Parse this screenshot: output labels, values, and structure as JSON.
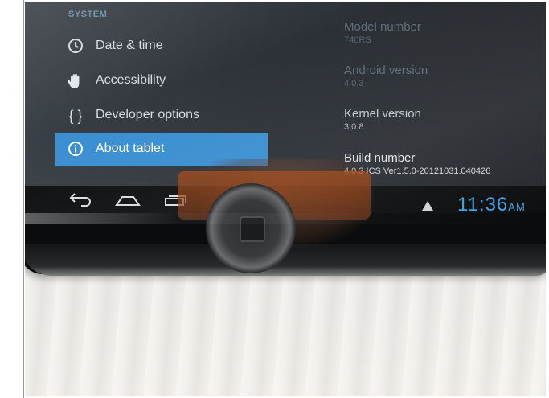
{
  "settings": {
    "section_header": "SYSTEM",
    "menu": [
      {
        "label": "Date & time",
        "icon": "clock-icon",
        "selected": false
      },
      {
        "label": "Accessibility",
        "icon": "hand-icon",
        "selected": false
      },
      {
        "label": "Developer options",
        "icon": "braces-icon",
        "selected": false
      },
      {
        "label": "About tablet",
        "icon": "info-icon",
        "selected": true
      }
    ],
    "about": {
      "model_title": "Model number",
      "model_value": "740RS",
      "android_title": "Android version",
      "android_value": "4.0.3",
      "kernel_title": "Kernel version",
      "kernel_value": "3.0.8",
      "build_title": "Build number",
      "build_value": "4.0.3 ICS Ver1.5.0-20121031.040426"
    }
  },
  "status_bar": {
    "time": "11:36",
    "ampm": "AM",
    "alert_icon": "warning-icon"
  },
  "nav_buttons": [
    "back-icon",
    "home-icon",
    "recent-apps-icon"
  ],
  "colors": {
    "selected_item": "#3a8fd1",
    "clock": "#3fa2e6",
    "section_header": "#6a8fa6"
  }
}
